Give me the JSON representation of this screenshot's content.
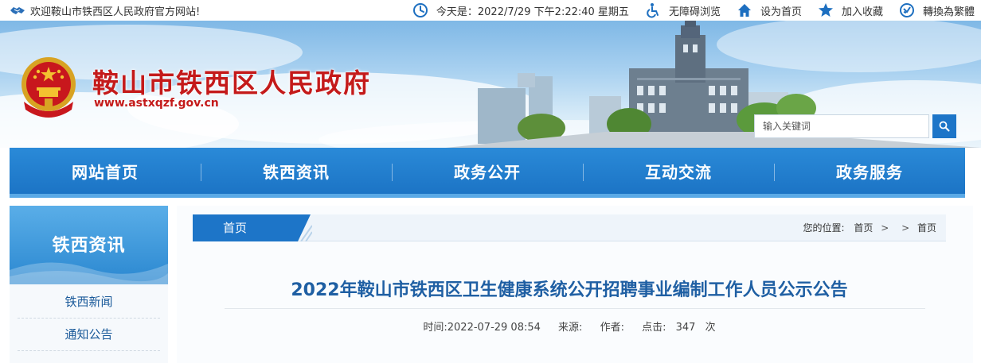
{
  "topbar": {
    "welcome": "欢迎鞍山市铁西区人民政府官方网站!",
    "date_prefix": "今天是：",
    "date_value": "2022/7/29 下午2:22:40 星期五",
    "accessibility": "无障碍浏览",
    "set_home": "设为首页",
    "add_favorite": "加入收藏",
    "convert_traditional": "轉換為繁體"
  },
  "banner": {
    "site_name": "鞍山市铁西区人民政府",
    "site_url": "www.astxqzf.gov.cn"
  },
  "search": {
    "placeholder": "输入关键词"
  },
  "nav": {
    "items": [
      {
        "label": "网站首页"
      },
      {
        "label": "铁西资讯"
      },
      {
        "label": "政务公开"
      },
      {
        "label": "互动交流"
      },
      {
        "label": "政务服务"
      }
    ]
  },
  "sidebar": {
    "title": "铁西资讯",
    "links": [
      {
        "label": "铁西新闻"
      },
      {
        "label": "通知公告"
      }
    ]
  },
  "breadcrumb": {
    "tab": "首页",
    "location_label": "您的位置:",
    "home": "首页",
    "sep1": ">",
    "sep2": ">",
    "current": "首页"
  },
  "article": {
    "title": "2022年鞍山市铁西区卫生健康系统公开招聘事业编制工作人员公示公告",
    "time_label": "时间:",
    "time_value": "2022-07-29 08:54",
    "source_label": "来源:",
    "author_label": "作者:",
    "clicks_label": "点击:",
    "clicks_value": "347",
    "clicks_unit": "次"
  },
  "colors": {
    "nav_blue": "#1c74c5",
    "title_red": "#c41a1a",
    "article_title": "#1f5fa3"
  }
}
